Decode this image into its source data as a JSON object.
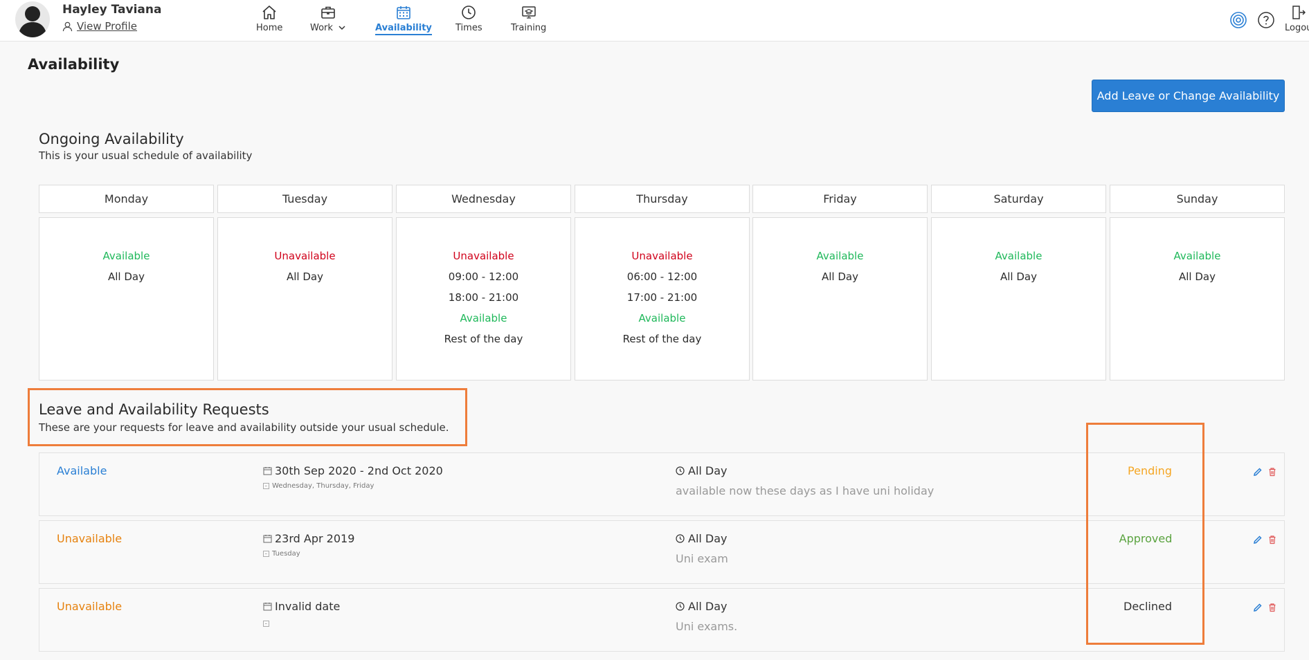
{
  "user": {
    "name": "Hayley Taviana",
    "view_profile": "View Profile"
  },
  "nav": [
    {
      "label": "Home",
      "icon": "home-icon"
    },
    {
      "label": "Work",
      "icon": "briefcase-icon"
    },
    {
      "label": "Availability",
      "icon": "calendar-icon",
      "active": true
    },
    {
      "label": "Times",
      "icon": "clock-icon"
    },
    {
      "label": "Training",
      "icon": "training-icon"
    }
  ],
  "header_right": {
    "logout_label": "Logou"
  },
  "page": {
    "title": "Availability",
    "add_button": "Add Leave or Change Availability"
  },
  "ongoing": {
    "title": "Ongoing Availability",
    "subtitle": "This is your usual schedule of availability",
    "days": [
      {
        "day": "Monday",
        "lines": [
          {
            "text": "Available",
            "kind": "green"
          },
          {
            "text": "All Day",
            "kind": "plain"
          }
        ]
      },
      {
        "day": "Tuesday",
        "lines": [
          {
            "text": "Unavailable",
            "kind": "red"
          },
          {
            "text": "All Day",
            "kind": "plain"
          }
        ]
      },
      {
        "day": "Wednesday",
        "lines": [
          {
            "text": "Unavailable",
            "kind": "red"
          },
          {
            "text": "09:00 - 12:00",
            "kind": "plain"
          },
          {
            "text": "18:00 - 21:00",
            "kind": "plain"
          },
          {
            "text": "Available",
            "kind": "green"
          },
          {
            "text": "Rest of the day",
            "kind": "plain"
          }
        ]
      },
      {
        "day": "Thursday",
        "lines": [
          {
            "text": "Unavailable",
            "kind": "red"
          },
          {
            "text": "06:00 - 12:00",
            "kind": "plain"
          },
          {
            "text": "17:00 - 21:00",
            "kind": "plain"
          },
          {
            "text": "Available",
            "kind": "green"
          },
          {
            "text": "Rest of the day",
            "kind": "plain"
          }
        ]
      },
      {
        "day": "Friday",
        "lines": [
          {
            "text": "Available",
            "kind": "green"
          },
          {
            "text": "All Day",
            "kind": "plain"
          }
        ]
      },
      {
        "day": "Saturday",
        "lines": [
          {
            "text": "Available",
            "kind": "green"
          },
          {
            "text": "All Day",
            "kind": "plain"
          }
        ]
      },
      {
        "day": "Sunday",
        "lines": [
          {
            "text": "Available",
            "kind": "green"
          },
          {
            "text": "All Day",
            "kind": "plain"
          }
        ]
      }
    ]
  },
  "requests": {
    "title": "Leave and Availability Requests",
    "subtitle": "These are your requests for leave and availability outside your usual schedule.",
    "rows": [
      {
        "type": "Available",
        "type_color": "blue",
        "date": "30th Sep 2020 - 2nd Oct 2020",
        "days": "Wednesday, Thursday, Friday",
        "time": "All Day",
        "note": "available now these days as I have uni holiday",
        "status": "Pending"
      },
      {
        "type": "Unavailable",
        "type_color": "orange",
        "date": "23rd Apr 2019",
        "days": "Tuesday",
        "time": "All Day",
        "note": "Uni exam",
        "status": "Approved"
      },
      {
        "type": "Unavailable",
        "type_color": "orange",
        "date": "Invalid date",
        "days": "",
        "time": "All Day",
        "note": "Uni exams.",
        "status": "Declined"
      }
    ]
  },
  "colors": {
    "accent": "#2a7fd4",
    "available": "#1fb85a",
    "unavailable": "#d0021b",
    "request_unavailable": "#e6820f",
    "pending": "#f5a623",
    "approved": "#5aa33f",
    "highlight": "#ee7d3b"
  }
}
